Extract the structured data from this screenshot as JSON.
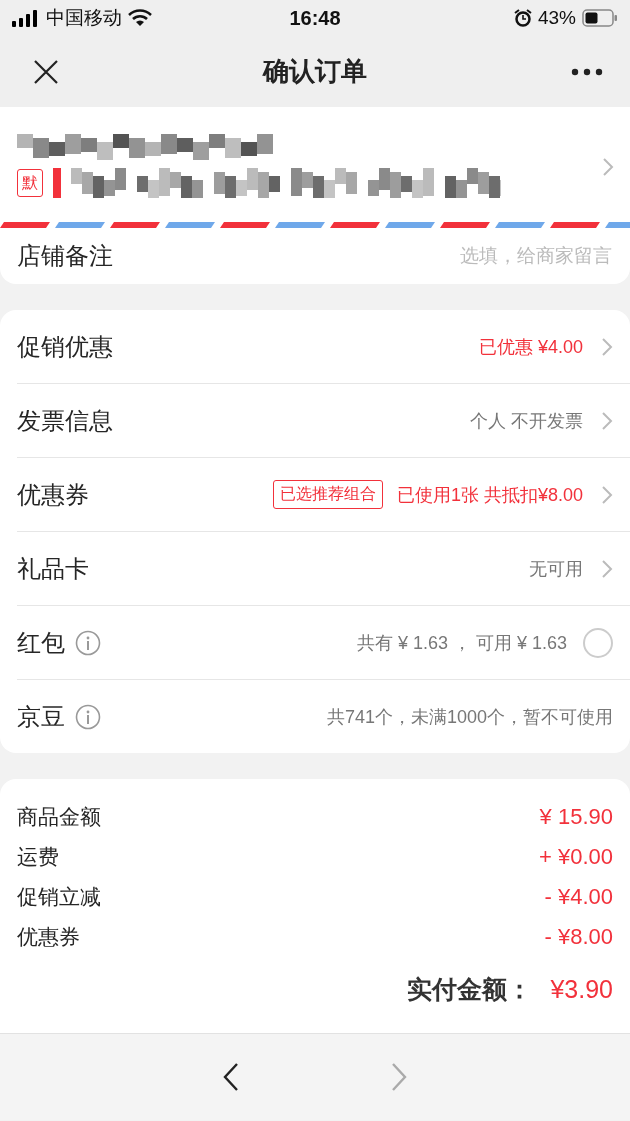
{
  "status_bar": {
    "carrier": "中国移动",
    "time": "16:48",
    "battery": "43%"
  },
  "nav": {
    "title": "确认订单"
  },
  "address": {
    "default_tag": "默"
  },
  "note_row": {
    "label": "店铺备注",
    "placeholder": "选填，给商家留言"
  },
  "options": [
    {
      "label": "促销优惠",
      "info": false,
      "value": "已优惠 ¥4.00",
      "emphasis": true,
      "kind": "chevron"
    },
    {
      "label": "发票信息",
      "info": false,
      "value": "个人 不开发票",
      "emphasis": false,
      "kind": "chevron"
    },
    {
      "label": "优惠券",
      "info": false,
      "tag": "已选推荐组合",
      "value": "已使用1张 共抵扣¥8.00",
      "emphasis": true,
      "kind": "chevron"
    },
    {
      "label": "礼品卡",
      "info": false,
      "value": "无可用",
      "emphasis": false,
      "kind": "chevron"
    },
    {
      "label": "红包",
      "info": true,
      "value": "共有 ¥ 1.63 ， 可用 ¥ 1.63",
      "emphasis": false,
      "kind": "radio",
      "checked": false
    },
    {
      "label": "京豆",
      "info": true,
      "value": "共741个，未满1000个，暂不可使用",
      "emphasis": false,
      "kind": "plain"
    }
  ],
  "summary": {
    "lines": [
      {
        "label": "商品金额",
        "amount": "¥ 15.90"
      },
      {
        "label": "运费",
        "amount": "+ ¥0.00"
      },
      {
        "label": "促销立减",
        "amount": "- ¥4.00"
      },
      {
        "label": "优惠券",
        "amount": "- ¥8.00"
      }
    ],
    "total_label": "实付金额：",
    "total_amount": "¥3.90"
  },
  "toolbar": {
    "back": {
      "disabled": false
    },
    "forward": {
      "disabled": true
    }
  }
}
